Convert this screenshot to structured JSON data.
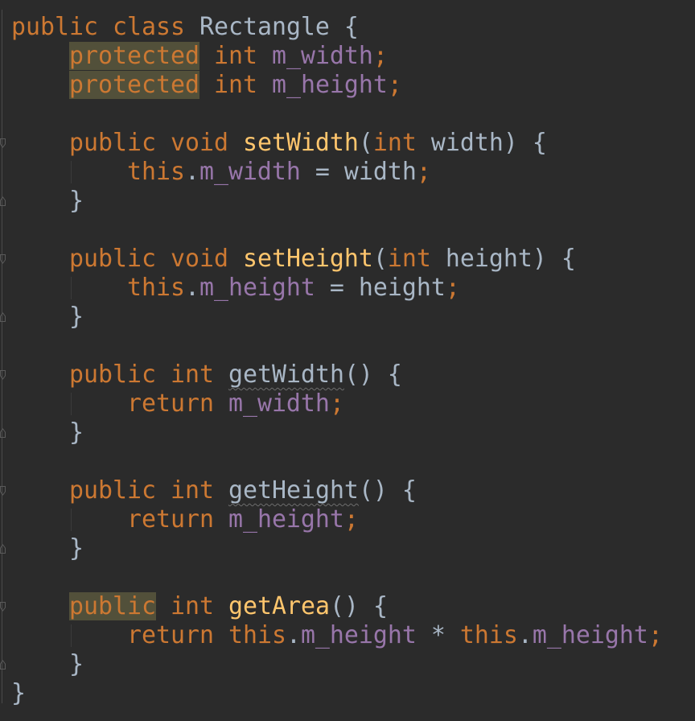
{
  "editor": {
    "lines": [
      [
        {
          "t": "public",
          "s": "kw"
        },
        {
          "t": " "
        },
        {
          "t": "class",
          "s": "kw"
        },
        {
          "t": " Rectangle {",
          "s": "plain"
        }
      ],
      [
        {
          "t": "    "
        },
        {
          "t": "protected",
          "s": "kw hl"
        },
        {
          "t": " "
        },
        {
          "t": "int",
          "s": "kw"
        },
        {
          "t": " "
        },
        {
          "t": "m_width",
          "s": "fld"
        },
        {
          "t": ";",
          "s": "kw"
        }
      ],
      [
        {
          "t": "    "
        },
        {
          "t": "protected",
          "s": "kw hl"
        },
        {
          "t": " "
        },
        {
          "t": "int",
          "s": "kw"
        },
        {
          "t": " "
        },
        {
          "t": "m_height",
          "s": "fld"
        },
        {
          "t": ";",
          "s": "kw"
        }
      ],
      [],
      [
        {
          "t": "    "
        },
        {
          "t": "public",
          "s": "kw"
        },
        {
          "t": " "
        },
        {
          "t": "void",
          "s": "kw"
        },
        {
          "t": " "
        },
        {
          "t": "setWidth",
          "s": "mth"
        },
        {
          "t": "(",
          "s": "plain"
        },
        {
          "t": "int",
          "s": "kw"
        },
        {
          "t": " width) {",
          "s": "plain"
        }
      ],
      [
        {
          "t": "        "
        },
        {
          "t": "this",
          "s": "kw"
        },
        {
          "t": ".",
          "s": "plain"
        },
        {
          "t": "m_width",
          "s": "fld"
        },
        {
          "t": " = width",
          "s": "plain"
        },
        {
          "t": ";",
          "s": "kw"
        }
      ],
      [
        {
          "t": "    "
        },
        {
          "t": "}",
          "s": "plain"
        }
      ],
      [],
      [
        {
          "t": "    "
        },
        {
          "t": "public",
          "s": "kw"
        },
        {
          "t": " "
        },
        {
          "t": "void",
          "s": "kw"
        },
        {
          "t": " "
        },
        {
          "t": "setHeight",
          "s": "mth"
        },
        {
          "t": "(",
          "s": "plain"
        },
        {
          "t": "int",
          "s": "kw"
        },
        {
          "t": " height) {",
          "s": "plain"
        }
      ],
      [
        {
          "t": "        "
        },
        {
          "t": "this",
          "s": "kw"
        },
        {
          "t": ".",
          "s": "plain"
        },
        {
          "t": "m_height",
          "s": "fld"
        },
        {
          "t": " = height",
          "s": "plain"
        },
        {
          "t": ";",
          "s": "kw"
        }
      ],
      [
        {
          "t": "    "
        },
        {
          "t": "}",
          "s": "plain"
        }
      ],
      [],
      [
        {
          "t": "    "
        },
        {
          "t": "public",
          "s": "kw"
        },
        {
          "t": " "
        },
        {
          "t": "int",
          "s": "kw"
        },
        {
          "t": " "
        },
        {
          "t": "getWidth",
          "s": "unused"
        },
        {
          "t": "() {",
          "s": "plain"
        }
      ],
      [
        {
          "t": "        "
        },
        {
          "t": "return",
          "s": "kw"
        },
        {
          "t": " "
        },
        {
          "t": "m_width",
          "s": "fld"
        },
        {
          "t": ";",
          "s": "kw"
        }
      ],
      [
        {
          "t": "    "
        },
        {
          "t": "}",
          "s": "plain"
        }
      ],
      [],
      [
        {
          "t": "    "
        },
        {
          "t": "public",
          "s": "kw"
        },
        {
          "t": " "
        },
        {
          "t": "int",
          "s": "kw"
        },
        {
          "t": " "
        },
        {
          "t": "getHeight",
          "s": "unused"
        },
        {
          "t": "() {",
          "s": "plain"
        }
      ],
      [
        {
          "t": "        "
        },
        {
          "t": "return",
          "s": "kw"
        },
        {
          "t": " "
        },
        {
          "t": "m_height",
          "s": "fld"
        },
        {
          "t": ";",
          "s": "kw"
        }
      ],
      [
        {
          "t": "    "
        },
        {
          "t": "}",
          "s": "plain"
        }
      ],
      [],
      [
        {
          "t": "    "
        },
        {
          "t": "public",
          "s": "kw hl"
        },
        {
          "t": " "
        },
        {
          "t": "int",
          "s": "kw"
        },
        {
          "t": " "
        },
        {
          "t": "getArea",
          "s": "mth"
        },
        {
          "t": "() {",
          "s": "plain"
        }
      ],
      [
        {
          "t": "        "
        },
        {
          "t": "return",
          "s": "kw"
        },
        {
          "t": " "
        },
        {
          "t": "this",
          "s": "kw"
        },
        {
          "t": ".",
          "s": "plain"
        },
        {
          "t": "m_height",
          "s": "fld"
        },
        {
          "t": " * ",
          "s": "plain"
        },
        {
          "t": "this",
          "s": "kw"
        },
        {
          "t": ".",
          "s": "plain"
        },
        {
          "t": "m_height",
          "s": "fld"
        },
        {
          "t": ";",
          "s": "kw"
        }
      ],
      [
        {
          "t": "    "
        },
        {
          "t": "}",
          "s": "plain"
        }
      ],
      [
        {
          "t": "}",
          "s": "plain"
        }
      ]
    ]
  },
  "colors": {
    "background": "#2b2b2b",
    "keyword": "#cc7832",
    "field": "#9876aa",
    "method": "#ffc66d",
    "text": "#a9b7c6",
    "highlight": "#52503a"
  }
}
